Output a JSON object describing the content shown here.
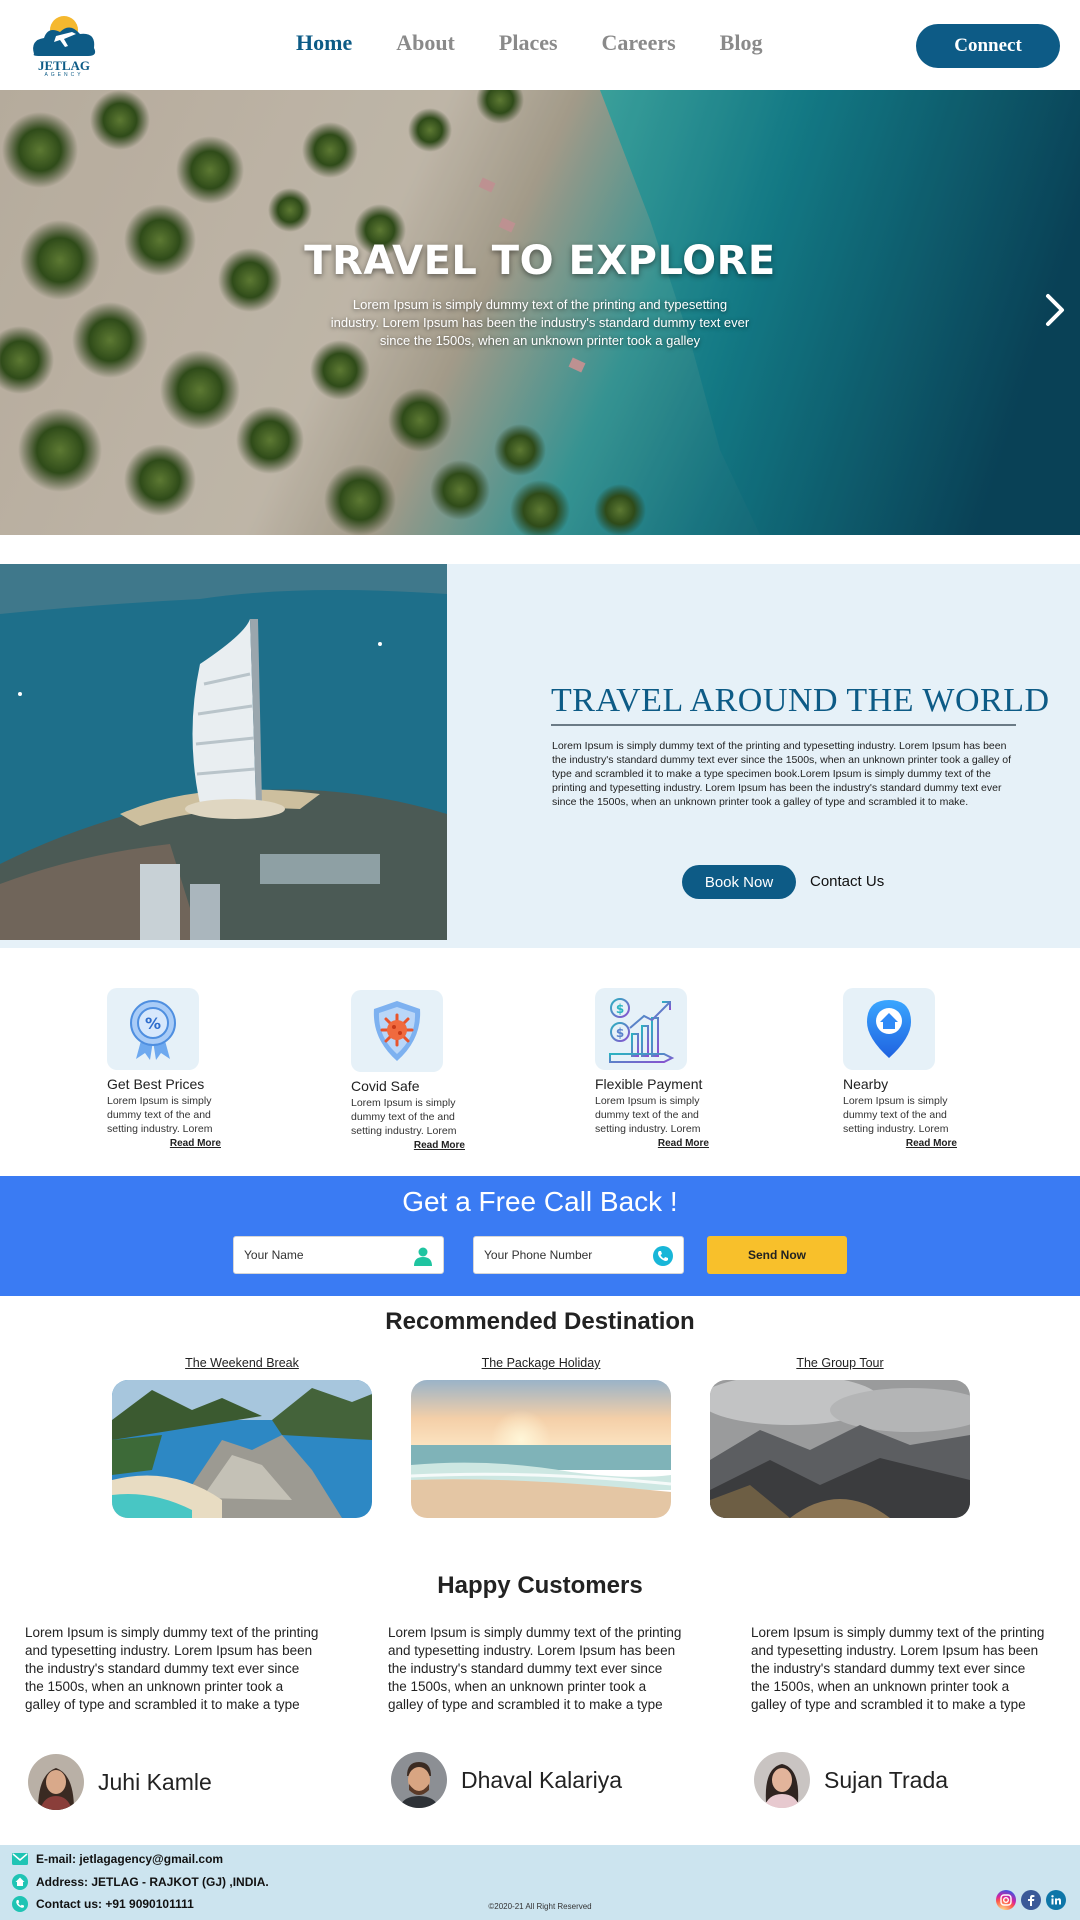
{
  "header": {
    "logo_text": "JETLAG",
    "logo_sub": "AGENCY",
    "nav": [
      {
        "label": "Home",
        "active": true
      },
      {
        "label": "About",
        "active": false
      },
      {
        "label": "Places",
        "active": false
      },
      {
        "label": "Careers",
        "active": false
      },
      {
        "label": "Blog",
        "active": false
      }
    ],
    "connect_label": "Connect"
  },
  "hero": {
    "title": "TRAVEL TO EXPLORE",
    "subtitle": "Lorem Ipsum is simply dummy text of the printing and typesetting industry. Lorem Ipsum has been the industry's standard dummy text ever since the 1500s, when an unknown printer took a galley",
    "next_icon": "chevron-right-icon"
  },
  "about": {
    "title": "TRAVEL AROUND THE WORLD",
    "text": "Lorem Ipsum is simply dummy text of the printing and typesetting industry. Lorem Ipsum has been the industry's standard dummy text ever since the 1500s, when an unknown printer took a galley of type and scrambled it to make a type specimen book.Lorem Ipsum is simply dummy text of the printing and typesetting industry. Lorem Ipsum has been the industry's standard dummy text ever since the 1500s, when an unknown printer took a galley of type and scrambled it to make.",
    "book_label": "Book Now",
    "contact_label": "Contact Us"
  },
  "features": [
    {
      "icon": "badge-percent-icon",
      "title": "Get Best Prices",
      "text": "Lorem Ipsum is simply dummy text of the and setting industry. Lorem",
      "read_more": "Read More"
    },
    {
      "icon": "virus-shield-icon",
      "title": "Covid Safe",
      "text": "Lorem Ipsum is simply dummy text of the and setting industry. Lorem",
      "read_more": "Read More"
    },
    {
      "icon": "payment-chart-icon",
      "title": "Flexible Payment",
      "text": "Lorem Ipsum is simply dummy text of the and setting industry. Lorem",
      "read_more": "Read More"
    },
    {
      "icon": "location-pin-icon",
      "title": "Nearby",
      "text": "Lorem Ipsum is simply dummy text of the and setting industry. Lorem",
      "read_more": "Read More"
    }
  ],
  "callback": {
    "title": "Get a Free Call Back !",
    "name_placeholder": "Your Name",
    "phone_placeholder": "Your Phone Number",
    "send_label": "Send Now"
  },
  "recommended": {
    "title": "Recommended Destination",
    "items": [
      {
        "label": "The Weekend Break"
      },
      {
        "label": "The Package Holiday"
      },
      {
        "label": "The Group Tour"
      }
    ]
  },
  "customers": {
    "title": "Happy Customers",
    "reviews": [
      {
        "text": "Lorem Ipsum is simply dummy text of the printing and typesetting industry. Lorem Ipsum has been the industry's standard dummy text ever since the 1500s, when an unknown printer took a galley of type and scrambled it to make a type specimen book.Lorem Ipsum is",
        "name": "Juhi Kamle"
      },
      {
        "text": "Lorem Ipsum is simply dummy text of the printing and typesetting industry. Lorem Ipsum has been the industry's standard dummy text ever since the 1500s, when an unknown printer took a galley of type and scrambled it to make a type specimen book.Lorem Ipsum is",
        "name": "Dhaval Kalariya"
      },
      {
        "text": "Lorem Ipsum is simply dummy text of the printing and typesetting industry. Lorem Ipsum has been the industry's standard dummy text ever since the 1500s, when an unknown printer took a galley of type and scrambled it to make a type specimen book.Lorem Ipsum is",
        "name": "Sujan Trada"
      }
    ]
  },
  "footer": {
    "email": "E-mail: jetlagagency@gmail.com",
    "address": "Address: JETLAG - RAJKOT (GJ) ,INDIA.",
    "contact": "Contact us: +91 9090101111",
    "copyright": "©2020-21  All Right Reserved",
    "social": [
      {
        "icon": "instagram-icon",
        "color": "#d6249f"
      },
      {
        "icon": "facebook-icon",
        "color": "#3b5998"
      },
      {
        "icon": "linkedin-icon",
        "color": "#0e76a8"
      }
    ]
  },
  "colors": {
    "brand": "#0d5b86",
    "callback_bg": "#3a7bf3",
    "send_button": "#f8c02b",
    "footer_bg": "#cce4ef",
    "about_bg": "#e6f1f8"
  }
}
